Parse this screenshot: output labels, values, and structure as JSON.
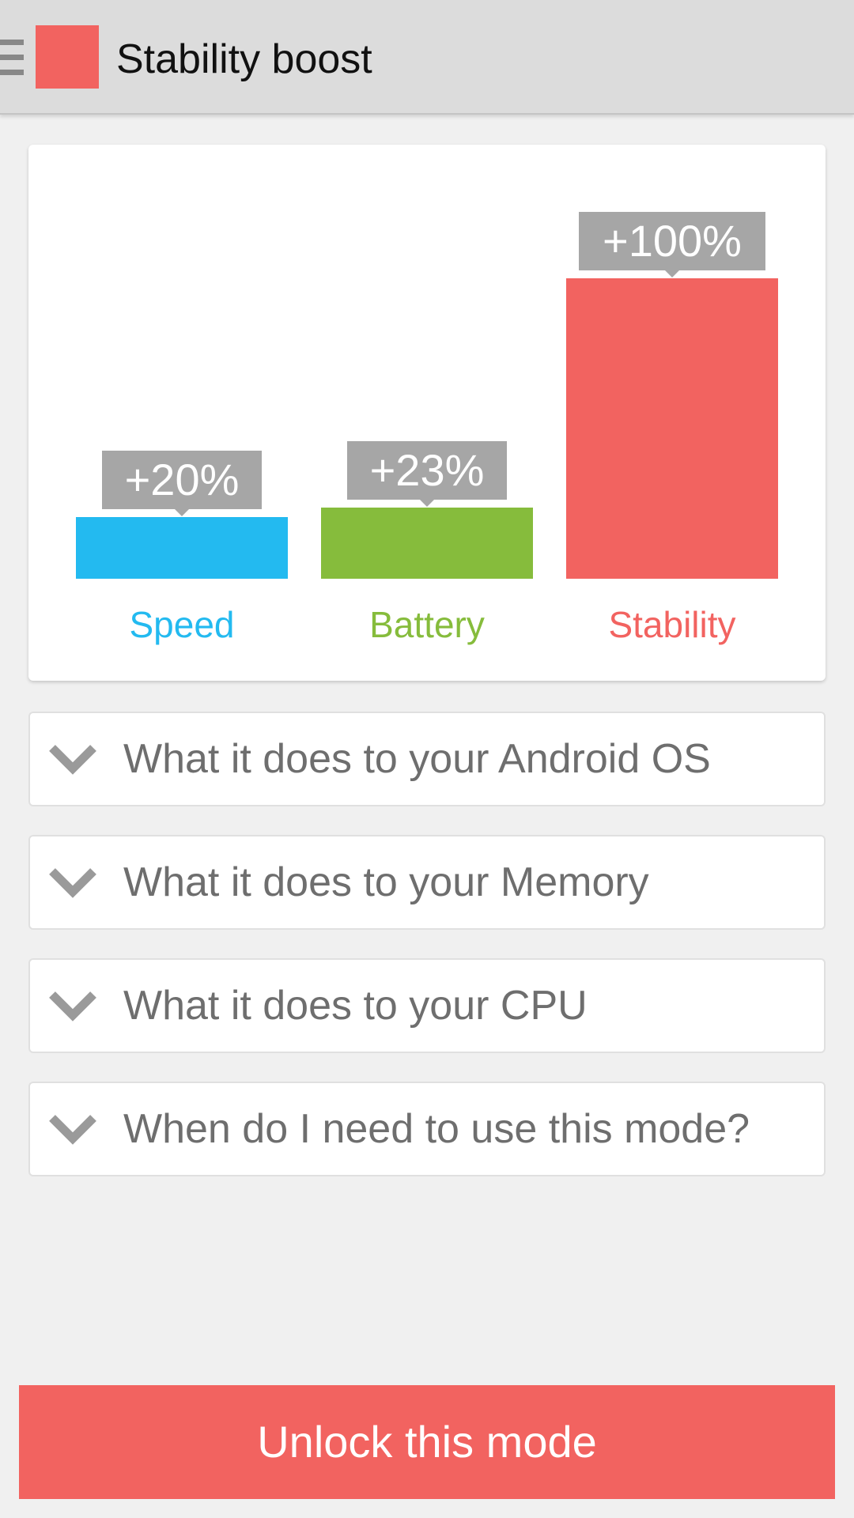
{
  "app_bar": {
    "title": "Stability boost",
    "icon_color": "#f26360",
    "menu_icon": "hamburger-menu-icon"
  },
  "chart_data": {
    "type": "bar",
    "categories": [
      "Speed",
      "Battery",
      "Stability"
    ],
    "values": [
      20,
      23,
      100
    ],
    "data_labels": [
      "+20%",
      "+23%",
      "+100%"
    ],
    "colors": [
      "#23baf0",
      "#86bc3c",
      "#f26360"
    ],
    "ylim": [
      0,
      100
    ],
    "grid": false,
    "legend": "none"
  },
  "faq": [
    {
      "question": "What it does to your Android OS",
      "icon": "chevron-down-icon"
    },
    {
      "question": "What it does to your Memory",
      "icon": "chevron-down-icon"
    },
    {
      "question": "What it does to your CPU",
      "icon": "chevron-down-icon"
    },
    {
      "question": "When do I need to use this mode?",
      "icon": "chevron-down-icon"
    }
  ],
  "cta": {
    "label": "Unlock this mode",
    "color": "#f26360"
  }
}
